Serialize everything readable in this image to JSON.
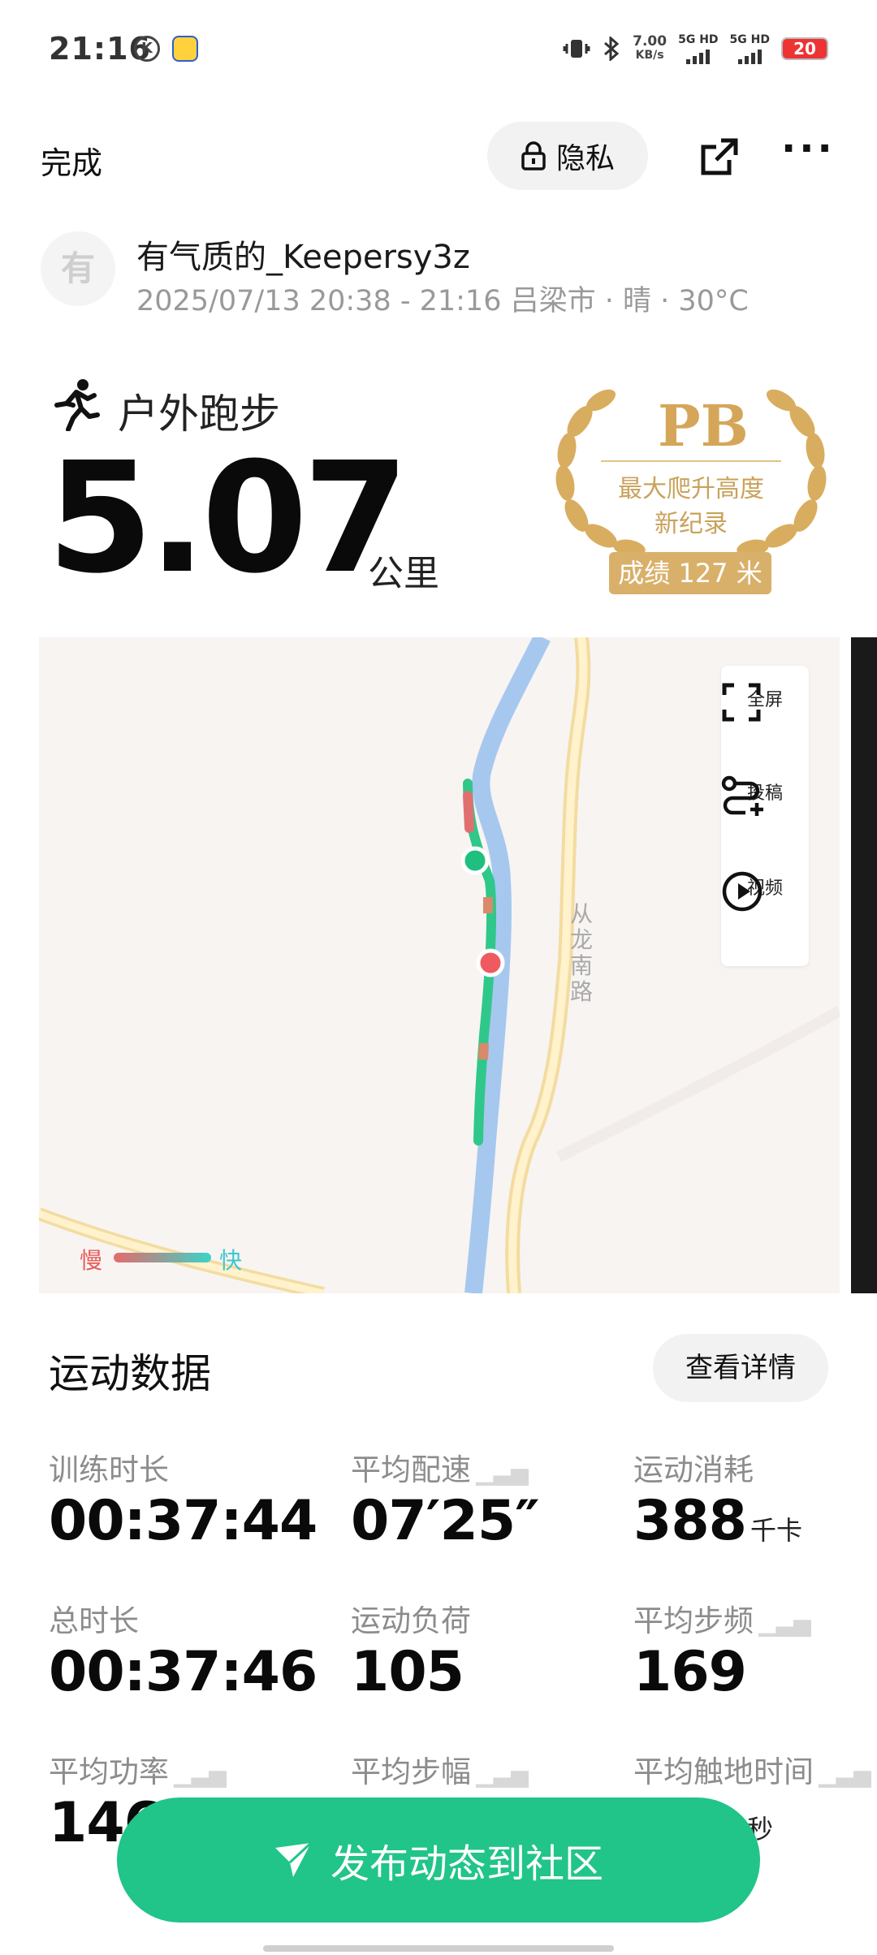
{
  "status_bar": {
    "time": "21:16",
    "net_speed_value": "7.00",
    "net_speed_unit": "KB/s",
    "sim1": "5G HD",
    "sim2": "5G HD",
    "battery": "20"
  },
  "header": {
    "done_label": "完成",
    "privacy_label": "隐私"
  },
  "user": {
    "avatar_text": "有",
    "name": "有气质的_Keepersy3z",
    "meta": "2025/07/13 20:38 - 21:16 吕梁市 · 晴 · 30°C"
  },
  "activity": {
    "type": "户外跑步",
    "distance": "5.07",
    "unit": "公里"
  },
  "badge": {
    "title": "PB",
    "line1": "最大爬升高度",
    "line2": "新纪录",
    "result": "成绩 127 米",
    "color": "#d5a65a"
  },
  "map": {
    "road_name": "从龙南路",
    "legend_slow": "慢",
    "legend_fast": "快",
    "tools": [
      {
        "label": "全屏",
        "icon": "fullscreen-icon"
      },
      {
        "label": "投稿",
        "icon": "submit-route-icon"
      },
      {
        "label": "视频",
        "icon": "play-video-icon"
      }
    ]
  },
  "stats": {
    "title": "运动数据",
    "details_button": "查看详情",
    "items": [
      {
        "label": "训练时长",
        "value": "00:37:44",
        "unit": ""
      },
      {
        "label": "平均配速",
        "value": "07′25″",
        "unit": ""
      },
      {
        "label": "运动消耗",
        "value": "388",
        "unit": "千卡"
      },
      {
        "label": "总时长",
        "value": "00:37:46",
        "unit": ""
      },
      {
        "label": "运动负荷",
        "value": "105",
        "unit": ""
      },
      {
        "label": "平均步频",
        "value": "169",
        "unit": ""
      },
      {
        "label": "平均功率",
        "value": "146",
        "unit": ""
      },
      {
        "label": "平均步幅",
        "value": "",
        "unit": ""
      },
      {
        "label": "平均触地时间",
        "value": "",
        "unit": "秒"
      }
    ]
  },
  "cta": {
    "label": "发布动态到社区",
    "color": "#21c489"
  }
}
